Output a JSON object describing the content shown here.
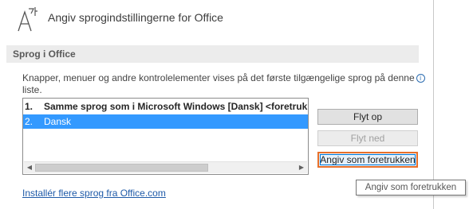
{
  "header": {
    "title": "Angiv sprogindstillingerne for Office",
    "icon": "language-icon"
  },
  "section": {
    "title": "Sprog i Office",
    "description_line1": "Knapper, menuer og andre kontrolelementer vises på det første tilgængelige sprog på denne",
    "description_line2": "liste."
  },
  "languages": [
    {
      "number": "1.",
      "label": "Samme sprog som i Microsoft Windows [Dansk] <foretrukken>"
    },
    {
      "number": "2.",
      "label": "Dansk"
    }
  ],
  "buttons": {
    "move_up": "Flyt op",
    "move_down": "Flyt ned",
    "set_preferred": "Angiv som foretrukken"
  },
  "tooltip": "Angiv som foretrukken",
  "install_link": "Installér flere sprog fra Office.com",
  "colors": {
    "selection": "#3399ff",
    "focus_highlight": "#e8702a",
    "link": "#1e5aa8"
  }
}
